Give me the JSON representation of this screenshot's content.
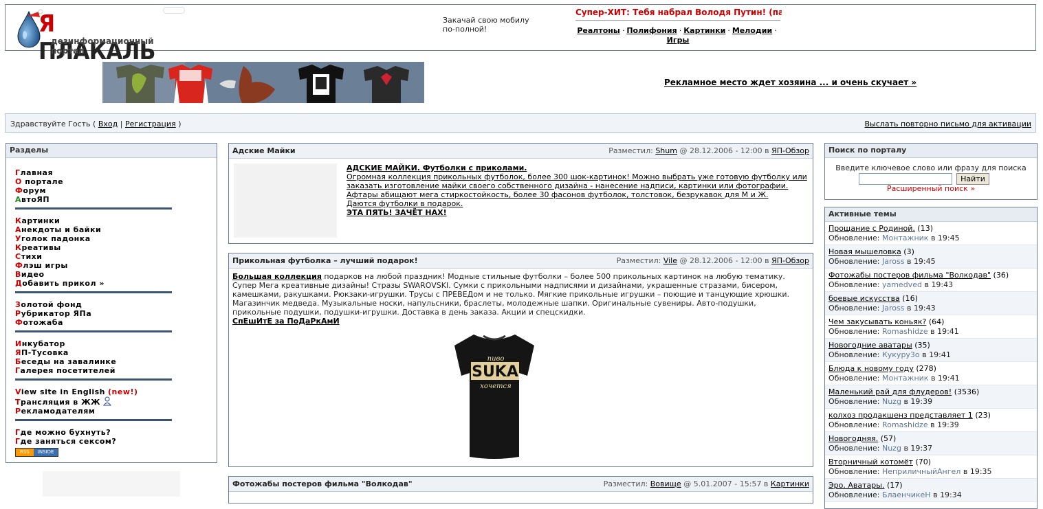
{
  "header": {
    "logo_word_ya": "Я",
    "logo_word_rest": " ПЛАКАЛЬ",
    "logo_tagline": "дезинформационный портал",
    "promo_line1": "Закачай свою мобилу",
    "promo_line2": "по-полной!",
    "hit_text": "Супер-ХИТ: Тебя набрал Володя Путин! (пар.",
    "ring_links": [
      "Реалтоны",
      "Полифония",
      "Картинки",
      "Мелодии",
      "Игры"
    ],
    "ring_sep": "·"
  },
  "banner": {
    "ad_text": "Рекламное место ждет хозяина ... и очень скучает »"
  },
  "userbar": {
    "greet_prefix": "Здравствуйте Гость (",
    "login": "Вход",
    "divider": "|",
    "register": "Регистрация",
    "greet_suffix": ")",
    "resend": "Выслать повторно письмо для активации"
  },
  "sidebar": {
    "title": "Разделы",
    "groups": [
      [
        {
          "first": "Г",
          "rest": "лавная"
        },
        {
          "first": "О",
          "rest": " портале"
        },
        {
          "first": "Ф",
          "rest": "орум"
        },
        {
          "first": "А",
          "rest": "втоЯП"
        }
      ],
      [
        {
          "first": "К",
          "rest": "артинки"
        },
        {
          "first": "А",
          "rest": "некдоты и байки"
        },
        {
          "first": "У",
          "rest": "голок падонка"
        },
        {
          "first": "К",
          "rest": "реативы"
        },
        {
          "first": "С",
          "rest": "тихи"
        },
        {
          "first": "Ф",
          "rest": "лэш игры"
        },
        {
          "first": "В",
          "rest": "идео"
        },
        {
          "first": "Д",
          "rest": "обавить прикол »"
        }
      ],
      [
        {
          "first": "З",
          "rest": "олотой фонд"
        },
        {
          "first": "Р",
          "rest": "убрикатор ЯПа"
        },
        {
          "first": "Ф",
          "rest": "отожаба"
        }
      ],
      [
        {
          "first": "И",
          "rest": "нкубатор"
        },
        {
          "first": "Я",
          "rest": "П-Тусовка"
        },
        {
          "first": "Б",
          "rest": "еседы на завалинке"
        },
        {
          "first": "Г",
          "rest": "алерея посетителей"
        }
      ],
      [
        {
          "first": "V",
          "rest": "iew site in English",
          "badge": "(new!)"
        },
        {
          "first": "Т",
          "rest": "рансляция в ЖЖ"
        },
        {
          "first": "Р",
          "rest": "екламодателям"
        }
      ],
      [
        {
          "first": "Г",
          "rest": "де можно бухнуть?"
        },
        {
          "first": "Г",
          "rest": "де заняться сексом?"
        }
      ]
    ],
    "rss_left": "RSS",
    "rss_right": "INSIDE"
  },
  "posts": [
    {
      "title": "Адские Майки",
      "meta_prefix": "Разместил:",
      "author": "Shum",
      "date": "@ 28.12.2006 - 12:00 в",
      "category": "ЯП-Обзор",
      "headline": "АДСКИЕ МАЙКИ. Футболки с приколами.",
      "body": "Огромная коллекция прикольных футболок, более 300 шок-картинок! Можно выбрать уже готовую футболку или заказать изготовление майки своего собственного дизайна - нанесение надписи, картинки или фотографии. Афтары абищают мега стиркостойкость, более 30 фасонов футболок, толстовок, безрукавок для М и Ж.",
      "body2": "Даются футболки в подарок.",
      "cta": "ЭТА ПЯТЬ! ЗАЧЁТ НАХ!"
    },
    {
      "title": "Прикольная футболка – лучший подарок!",
      "meta_prefix": "Разместил:",
      "author": "Vile",
      "date": "@ 28.12.2006 - 12:00 в",
      "category": "ЯП-Обзор",
      "lead_link": "Большая коллекция",
      "body": " подарков на любой праздник! Модные стильные футболки – более 500 прикольных картинок на любую тематику. Супер Мега креативные дизайны! Стразы SWAROVSKI. Сумки с прикольными надписями и дизайнами, украшенные стразами, бисером, камешками, ракушками. Рюкзаки-игрушки. Трусы с ПРЕВЕДом и не только. Мягкие прикольные игрушки – поющие и танцующие хрюшки. Магазинчик медведа. Музыкальные носки, напульсники, браслеты, молодежные шапки. Оригинальные сувениры. Авто-подушки, прикольные подушки, подушки-игрушки. Доставка в день заказа. Акции и спецскидки.",
      "cta": "СпЕшИтЕ за ПоДаРкАмИ",
      "shirt_top": "пиво",
      "shirt_word": "SUKA",
      "shirt_bottom": "хочется"
    },
    {
      "title": "Фотожабы постеров фильма \"Волкодав\"",
      "meta_prefix": "Разместил:",
      "author": "Вовище",
      "date": "@ 5.01.2007 - 15:57 в",
      "category": "Картинки"
    }
  ],
  "search": {
    "title": "Поиск по порталу",
    "hint": "Введите ключевое слово или фразу для поиска",
    "value": "",
    "button": "Найти",
    "advanced": "Расширенный поиск »"
  },
  "active": {
    "title": "Активные темы",
    "upd_label": "Обновление:",
    "at": "в",
    "topics": [
      {
        "name": "Прощание с Родиной.",
        "count": "(13)",
        "who": "Монтажник",
        "time": "19:45"
      },
      {
        "name": "Новая мышеловка",
        "count": "(3)",
        "who": "Jaross",
        "time": "19:45"
      },
      {
        "name": "Фотожабы постеров фильма \"Волкодав\"",
        "count": "(36)",
        "who": "yamedved",
        "time": "19:43"
      },
      {
        "name": "боевые искусства",
        "count": "(16)",
        "who": "Jaross",
        "time": "19:43"
      },
      {
        "name": "Чем закусывать коньяк?",
        "count": "(64)",
        "who": "Romashidze",
        "time": "19:41"
      },
      {
        "name": "Новогодние аватары",
        "count": "(35)",
        "who": "Кукуру3о",
        "time": "19:41"
      },
      {
        "name": "Блюда к новому году",
        "count": "(278)",
        "who": "Монтажник",
        "time": "19:41"
      },
      {
        "name": "Маленький рай для флудеров!",
        "count": "(3536)",
        "who": "Nuzg",
        "time": "19:39"
      },
      {
        "name": "колхоз продакшенз представляет 1",
        "count": "(23)",
        "who": "Romashidze",
        "time": "19:39"
      },
      {
        "name": "Новогодняя.",
        "count": "(57)",
        "who": "Nuzg",
        "time": "19:37"
      },
      {
        "name": "Вторничный котомёт",
        "count": "(70)",
        "who": "НеприличныйАнгел",
        "time": "19:35"
      },
      {
        "name": "Эро. Аватары.",
        "count": "(17)",
        "who": "БлаенчикеН",
        "time": "19:34"
      }
    ]
  },
  "colors": {
    "accent_red": "#cc0000",
    "border": "#6d7c92",
    "nav_divider": "#3a5473"
  }
}
